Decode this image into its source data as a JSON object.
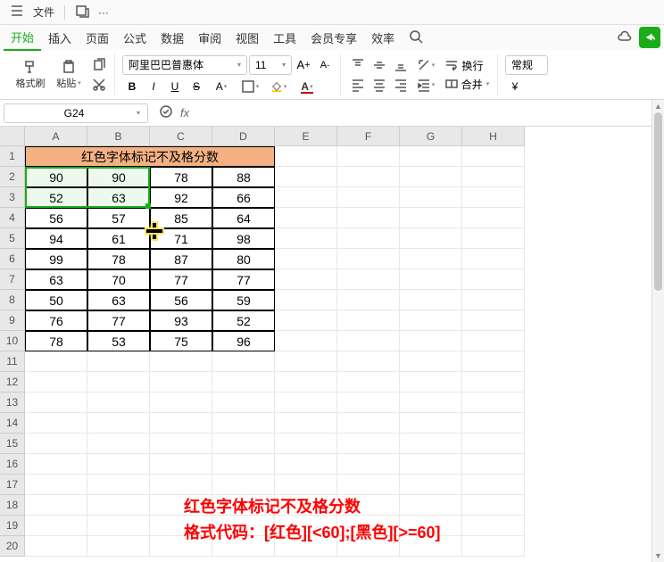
{
  "topbar": {
    "file": "文件",
    "more": "···"
  },
  "menu": {
    "tabs": [
      "开始",
      "插入",
      "页面",
      "公式",
      "数据",
      "审阅",
      "视图",
      "工具",
      "会员专享",
      "效率"
    ],
    "active_index": 0
  },
  "ribbon": {
    "format_painter": "格式刷",
    "paste": "粘贴",
    "font_name": "阿里巴巴普惠体",
    "font_size": "11",
    "wrap": "换行",
    "merge": "合并",
    "number_format": "常规"
  },
  "namebox": {
    "value": "G24"
  },
  "formula": {
    "value": ""
  },
  "columns": [
    "A",
    "B",
    "C",
    "D",
    "E",
    "F",
    "G",
    "H"
  ],
  "rows": [
    "1",
    "2",
    "3",
    "4",
    "5",
    "6",
    "7",
    "8",
    "9",
    "10",
    "11",
    "12",
    "13",
    "14",
    "15",
    "16",
    "17",
    "18",
    "19",
    "20"
  ],
  "merged_title": "红色字体标记不及格分数",
  "chart_data": {
    "type": "table",
    "title": "红色字体标记不及格分数",
    "columns": [
      "A",
      "B",
      "C",
      "D"
    ],
    "rows": [
      [
        90,
        90,
        78,
        88
      ],
      [
        52,
        63,
        92,
        66
      ],
      [
        56,
        57,
        85,
        64
      ],
      [
        94,
        61,
        71,
        98
      ],
      [
        99,
        78,
        87,
        80
      ],
      [
        63,
        70,
        77,
        77
      ],
      [
        50,
        63,
        56,
        59
      ],
      [
        76,
        77,
        93,
        52
      ],
      [
        78,
        53,
        75,
        96
      ]
    ]
  },
  "annotation": {
    "line1": "红色字体标记不及格分数",
    "line2": "格式代码：[红色][<60];[黑色][>=60]"
  }
}
